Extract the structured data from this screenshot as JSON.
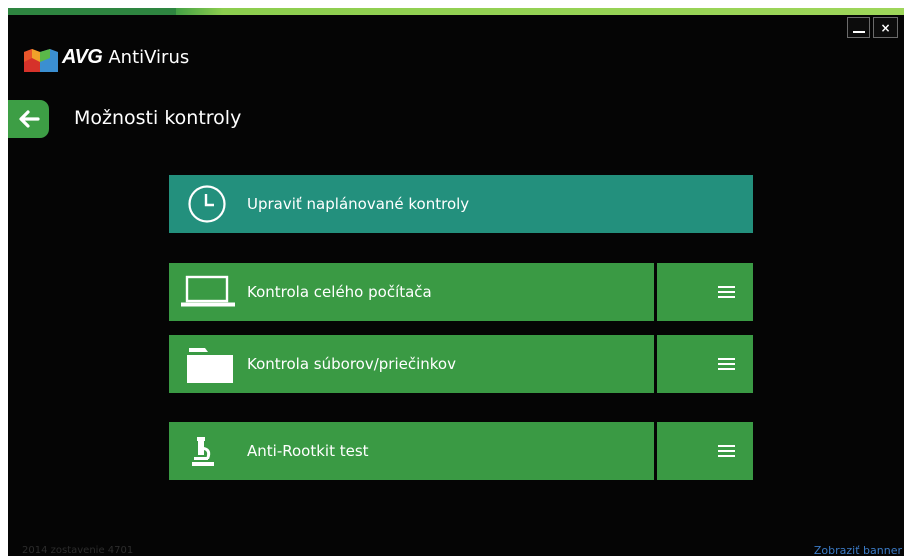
{
  "window": {
    "minimize_glyph": "_",
    "close_glyph": "×"
  },
  "brand": {
    "logo_text": "AVG",
    "product_name": "AntiVirus"
  },
  "page": {
    "title": "Možnosti kontroly"
  },
  "actions": {
    "scheduled": {
      "label": "Upraviť naplánované kontroly",
      "icon": "clock-icon"
    },
    "whole_computer": {
      "label": "Kontrola celého počítača",
      "icon": "laptop-icon"
    },
    "files_folders": {
      "label": "Kontrola súborov/priečinkov",
      "icon": "folder-icon"
    },
    "anti_rootkit": {
      "label": "Anti-Rootkit test",
      "icon": "microscope-icon"
    },
    "menu_icon": "hamburger-icon"
  },
  "footer": {
    "version_text": "2014 zostavenie 4701",
    "banner_link": "Zobraziť banner"
  },
  "colors": {
    "background": "#050505",
    "green": "#3a9a44",
    "teal": "#23907d",
    "link": "#3b7bc6"
  }
}
